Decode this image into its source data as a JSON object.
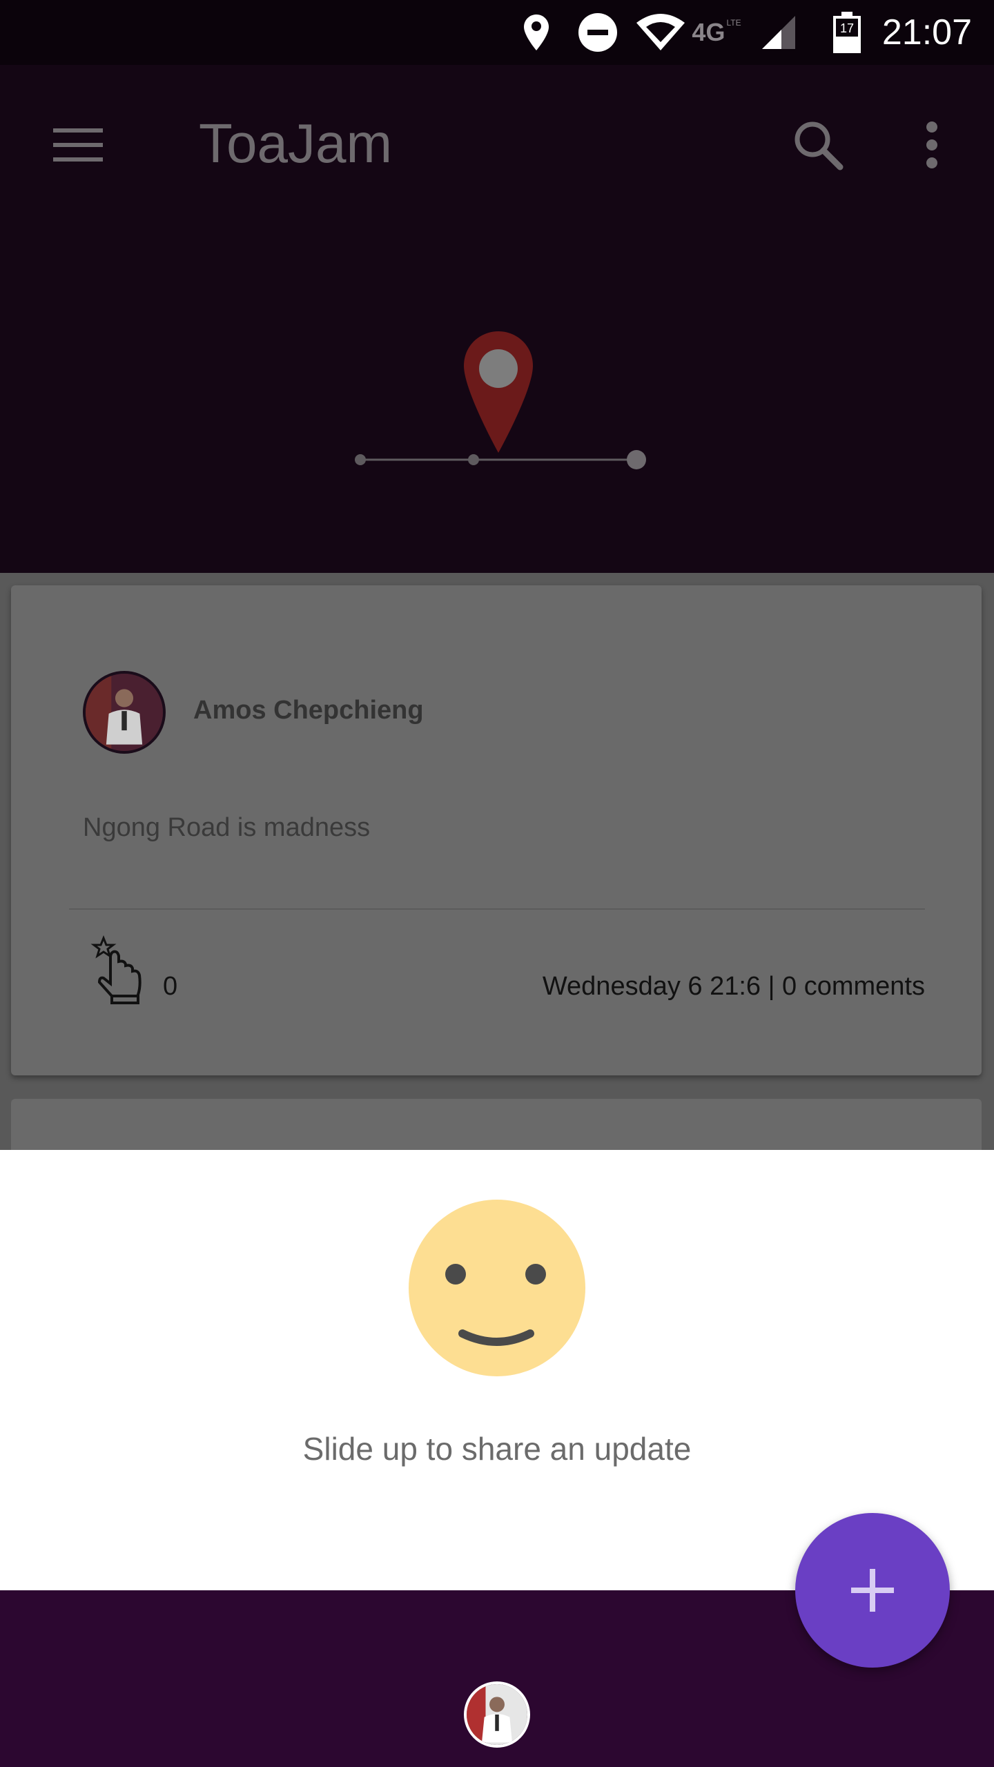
{
  "status_bar": {
    "time": "21:07",
    "network": "4G",
    "network_sub": "LTE",
    "battery": "17",
    "icons": [
      "location-icon",
      "dnd-icon",
      "wifi-icon",
      "signal-icon",
      "battery-icon"
    ]
  },
  "app_bar": {
    "title": "ToaJam",
    "icons": [
      "menu-icon",
      "search-icon",
      "more-vert-icon"
    ]
  },
  "header_graphic": {
    "icon": "location-pin-icon",
    "colors": {
      "pin": "#6b1a1a",
      "pin_dot": "#7d7d7d",
      "line": "#5e5a5e"
    }
  },
  "post": {
    "author": "Amos Chepchieng",
    "text": "Ngong Road is madness",
    "likes": "0",
    "meta": "Wednesday 6  21:6 | 0 comments"
  },
  "share_panel": {
    "label": "Slide up to share an update",
    "icon": "smiley-icon"
  },
  "fab": {
    "label": "+",
    "icon": "plus-icon"
  },
  "colors": {
    "brand": "#2c0730",
    "accent": "#6a3fc4",
    "smiley": "#fdde92",
    "scrim": "#140614"
  }
}
